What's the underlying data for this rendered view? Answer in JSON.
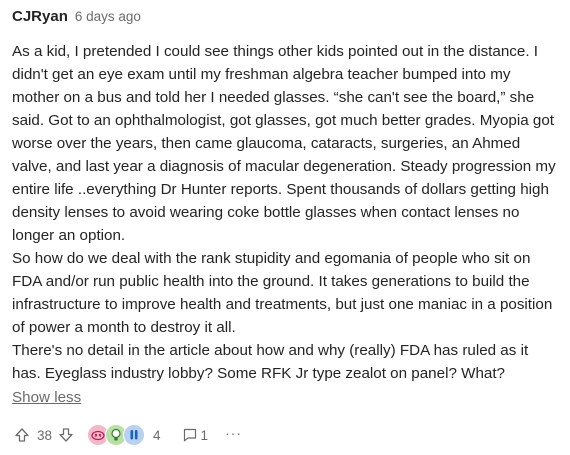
{
  "comment": {
    "author": "CJRyan",
    "timestamp": "6 days ago",
    "paragraphs": [
      "As a kid, I pretended I could see things other kids pointed out in the distance. I didn't get an eye exam until my freshman algebra teacher bumped into my mother on a bus and told her I needed glasses. “she can't see the board,” she said. Got to an ophthalmologist, got glasses, got much better grades. Myopia got worse over the years, then came glaucoma, cataracts, surgeries, an Ahmed valve, and last year a diagnosis of macular degeneration. Steady progression my entire life ..everything Dr Hunter reports. Spent thousands of dollars getting high density lenses to avoid wearing coke bottle glasses when contact lenses no longer an option.",
      "So how do we deal with the rank stupidity and egomania of people who sit on FDA and/or run public health into the ground. It takes generations to build the infrastructure to improve health and treatments, but just one maniac in a position of power a month to destroy it all.",
      "There's no detail in the article about how and why (really) FDA has ruled as it has. Eyeglass industry lobby? Some RFK Jr type zealot on panel? What?"
    ],
    "show_less_label": "Show less"
  },
  "actions": {
    "clap_count": "38",
    "reaction_count": "4",
    "reply_count": "1",
    "more_label": "···",
    "reaction_icons": [
      "heart-face-icon",
      "lightbulb-icon",
      "hands-icon"
    ],
    "colors": {
      "heart_bg": "#f2b8c6",
      "bulb_bg": "#b9dfa5",
      "hands_bg": "#b8d1ef",
      "muted": "#6b6b6b",
      "text": "#242424"
    }
  }
}
